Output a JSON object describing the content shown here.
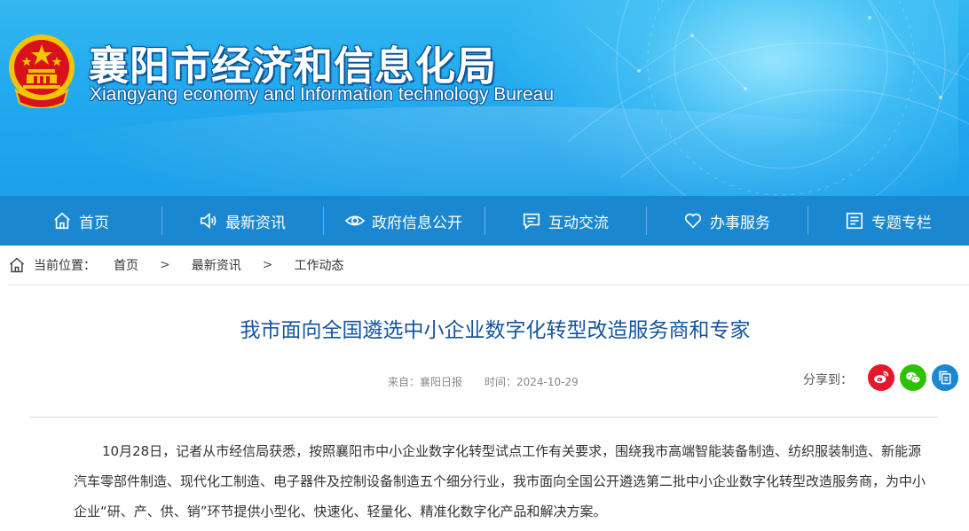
{
  "header": {
    "title_cn": "襄阳市经济和信息化局",
    "title_en": "Xiangyang economy and Information technology Bureau",
    "colors": {
      "banner": "#22a9ee",
      "emblem_red": "#d8121b",
      "emblem_gold": "#f5c400"
    }
  },
  "nav": {
    "items": [
      {
        "label": "首页",
        "icon": "home-icon"
      },
      {
        "label": "最新资讯",
        "icon": "speaker-icon"
      },
      {
        "label": "政府信息公开",
        "icon": "eye-icon"
      },
      {
        "label": "互动交流",
        "icon": "message-icon"
      },
      {
        "label": "办事服务",
        "icon": "heart-icon"
      },
      {
        "label": "专题专栏",
        "icon": "list-board-icon"
      }
    ],
    "color": "#1b87d0"
  },
  "breadcrumb": {
    "label": "当前位置：",
    "items": [
      "首页",
      "最新资讯",
      "工作动态"
    ],
    "separator": ">"
  },
  "article": {
    "title": "我市面向全国遴选中小企业数字化转型改造服务商和专家",
    "source": "来自：襄阳日报",
    "time": "时间：2024-10-29",
    "share_label": "分享到：",
    "share_targets": [
      {
        "name": "weibo-icon",
        "color": "#e6162d"
      },
      {
        "name": "wechat-icon",
        "color": "#2dc100"
      },
      {
        "name": "copy-icon",
        "color": "#1b87d0"
      }
    ],
    "body": "10月28日，记者从市经信局获悉，按照襄阳市中小企业数字化转型试点工作有关要求，围绕我市高端智能装备制造、纺织服装制造、新能源汽车零部件制造、现代化工制造、电子器件及控制设备制造五个细分行业，我市面向全国公开遴选第二批中小企业数字化转型改造服务商，为中小企业“研、产、供、销”环节提供小型化、快速化、轻量化、精准化数字化产品和解决方案。",
    "title_color": "#1655a0"
  }
}
